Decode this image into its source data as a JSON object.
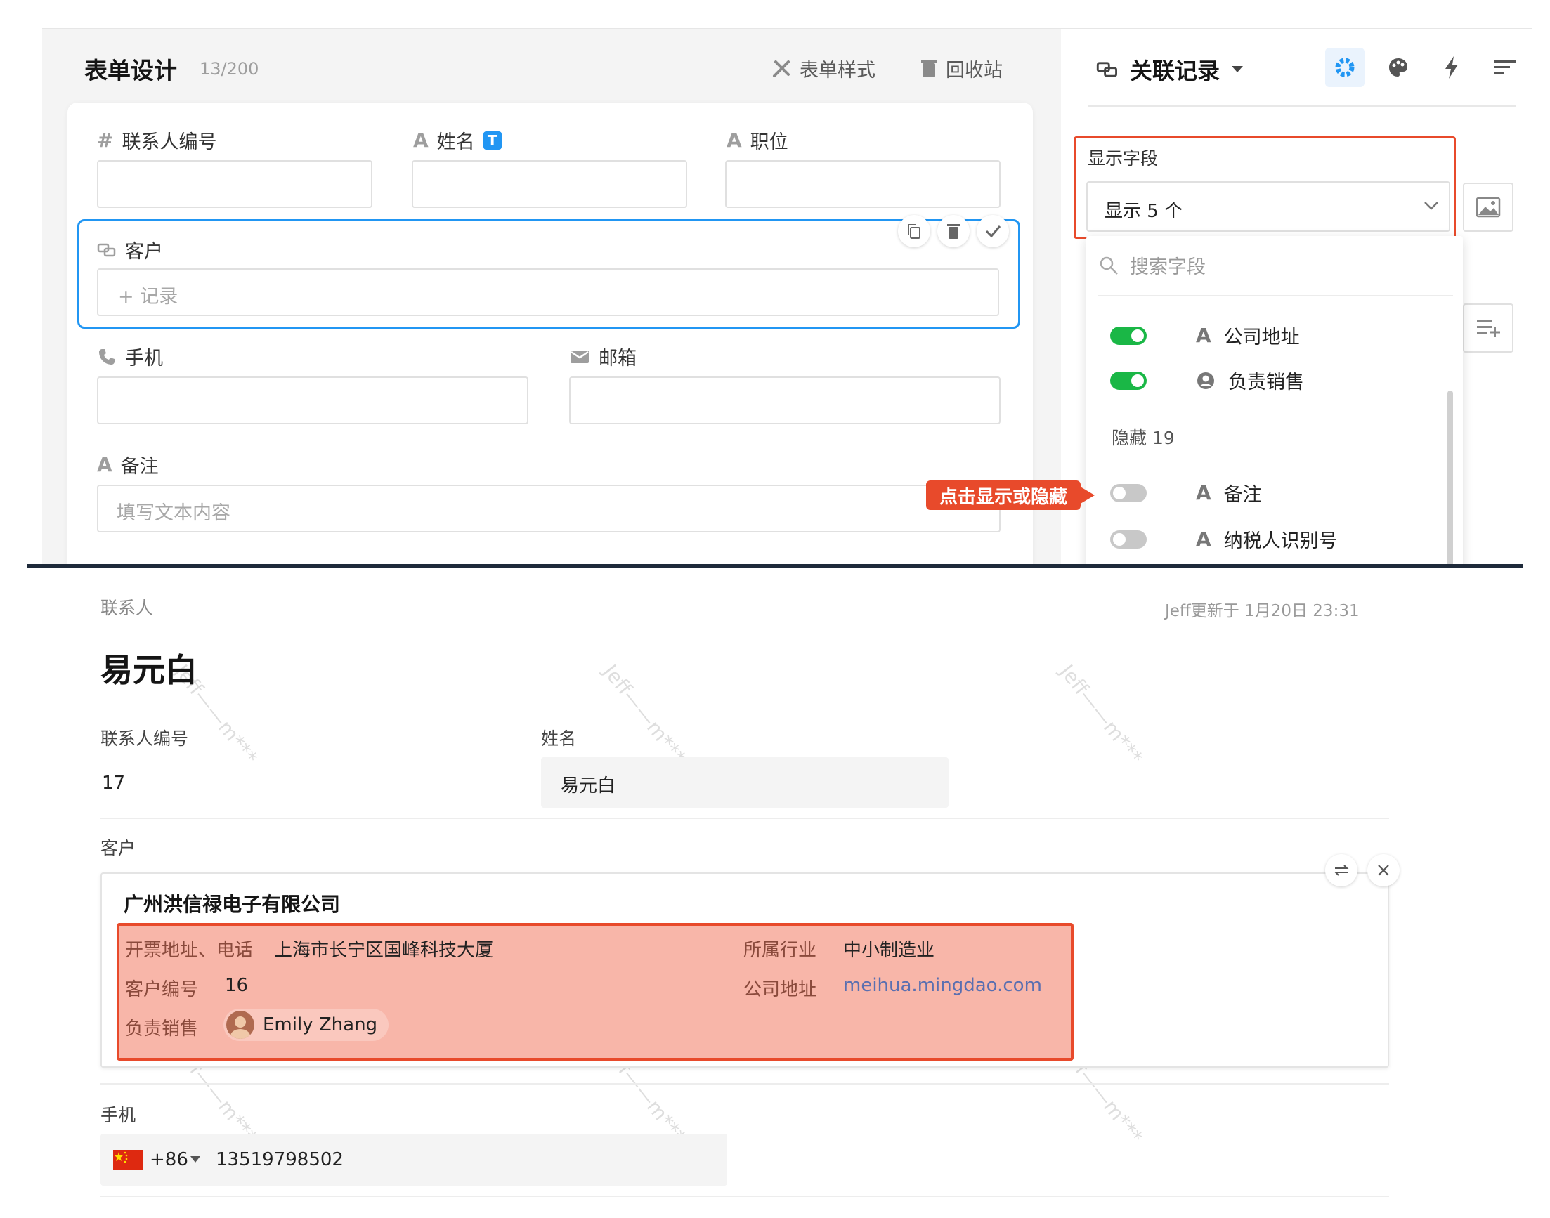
{
  "form_designer": {
    "title": "表单设计",
    "count": "13/200",
    "style_link": "表单样式",
    "trash_link": "回收站",
    "fields": [
      {
        "icon": "#",
        "label": "联系人编号"
      },
      {
        "icon": "A",
        "label": "姓名",
        "badge": "T"
      },
      {
        "icon": "A",
        "label": "职位"
      },
      {
        "label": "客户",
        "placeholder": "+ 记录"
      },
      {
        "label": "手机"
      },
      {
        "label": "邮箱"
      },
      {
        "icon": "A",
        "label": "备注",
        "placeholder": "填写文本内容"
      }
    ]
  },
  "right_panel": {
    "title": "关联记录",
    "display_fields_label": "显示字段",
    "display_select_value": "显示 5 个",
    "search_placeholder": "搜索字段",
    "shown_items": [
      {
        "label": "公司地址",
        "on": true,
        "icon": "A"
      },
      {
        "label": "负责销售",
        "on": true,
        "icon": "user"
      }
    ],
    "hidden_header": "隐藏 19",
    "hidden_items": [
      {
        "label": "备注",
        "on": false,
        "icon": "A"
      },
      {
        "label": "纳税人识别号",
        "on": false,
        "icon": "A"
      }
    ],
    "hint": "点击显示或隐藏"
  },
  "record": {
    "breadcrumb": "联系人",
    "updated": "Jeff更新于 1月20日 23:31",
    "name": "易元白",
    "watermark": "Jeff——m***",
    "fields": {
      "contact_no_label": "联系人编号",
      "contact_no_value": "17",
      "name_label": "姓名",
      "name_value": "易元白",
      "customer_label": "客户",
      "phone_label": "手机",
      "phone_code": "+86",
      "phone_value": "13519798502"
    },
    "customer_card": {
      "company": "广州洪信禄电子有限公司",
      "invoice_label": "开票地址、电话",
      "invoice_value": "上海市长宁区国峰科技大厦",
      "industry_label": "所属行业",
      "industry_value": "中小制造业",
      "cust_no_label": "客户编号",
      "cust_no_value": "16",
      "address_label": "公司地址",
      "address_value": "meihua.mingdao.com",
      "sales_label": "负责销售",
      "sales_value": "Emily Zhang"
    }
  },
  "colors": {
    "accent_blue": "#2196f3",
    "toggle_green": "#1ab746",
    "highlight_red": "#e84a2b",
    "link": "#5a6fb0"
  }
}
